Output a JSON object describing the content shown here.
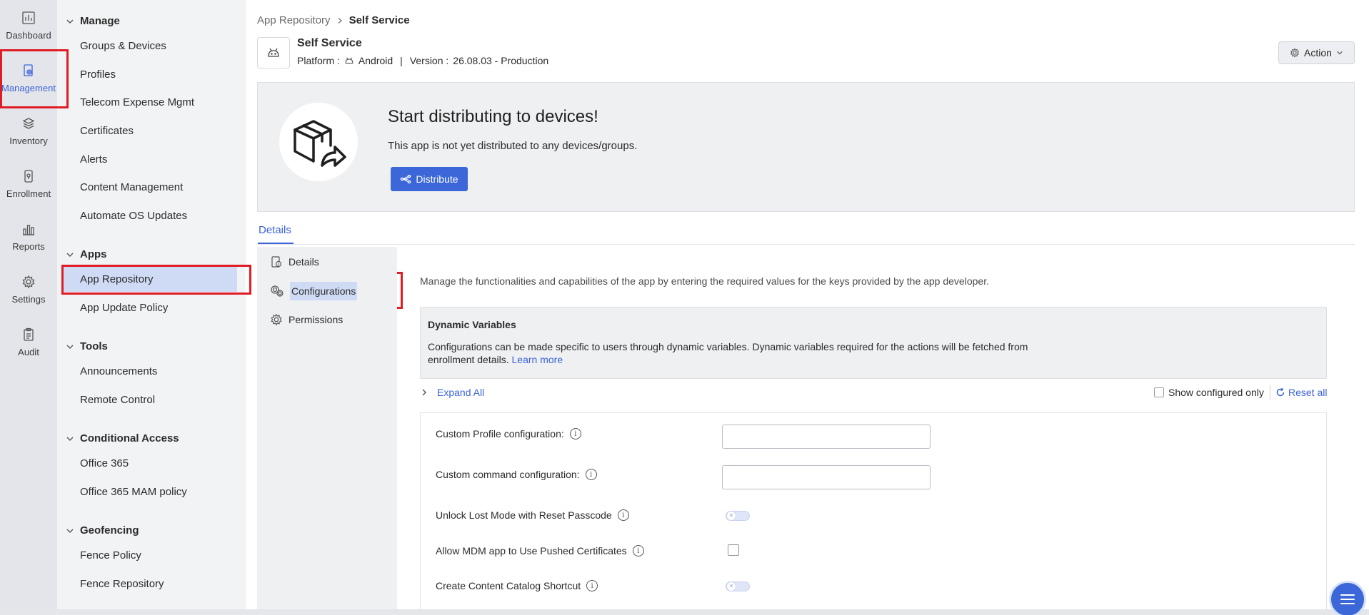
{
  "rail": [
    {
      "label": "Dashboard",
      "icon": "dashboard-icon"
    },
    {
      "label": "Management",
      "icon": "management-icon"
    },
    {
      "label": "Inventory",
      "icon": "inventory-icon"
    },
    {
      "label": "Enrollment",
      "icon": "enrollment-icon"
    },
    {
      "label": "Reports",
      "icon": "reports-icon"
    },
    {
      "label": "Settings",
      "icon": "settings-icon"
    },
    {
      "label": "Audit",
      "icon": "audit-icon"
    }
  ],
  "nav": {
    "manage": {
      "title": "Manage",
      "items": [
        "Groups & Devices",
        "Profiles",
        "Telecom Expense Mgmt",
        "Certificates",
        "Alerts",
        "Content Management",
        "Automate OS Updates"
      ]
    },
    "apps": {
      "title": "Apps",
      "items": [
        "App Repository",
        "App Update Policy"
      ]
    },
    "tools": {
      "title": "Tools",
      "items": [
        "Announcements",
        "Remote Control"
      ]
    },
    "conditional": {
      "title": "Conditional Access",
      "items": [
        "Office 365",
        "Office 365 MAM policy"
      ]
    },
    "geofencing": {
      "title": "Geofencing",
      "items": [
        "Fence Policy",
        "Fence Repository"
      ]
    }
  },
  "breadcrumb": {
    "parent": "App Repository",
    "current": "Self Service"
  },
  "app": {
    "name": "Self Service",
    "platform_label": "Platform :",
    "platform": "Android",
    "separator": "|",
    "version_label": "Version :",
    "version": "26.08.03 - Production"
  },
  "action_label": "Action",
  "banner": {
    "title": "Start distributing to devices!",
    "text": "This app is not yet distributed to any devices/groups.",
    "button": "Distribute"
  },
  "tab": "Details",
  "subnav": [
    "Details",
    "Configurations",
    "Permissions"
  ],
  "content": {
    "description": "Manage the functionalities and capabilities of the app by entering the required values for the keys provided by the app developer.",
    "dynamic": {
      "title": "Dynamic Variables",
      "text": "Configurations can be made specific to users through dynamic variables. Dynamic variables required for the actions will be fetched from enrollment details.",
      "link": "Learn more"
    },
    "expand_all": "Expand All",
    "show_configured": "Show configured only",
    "reset_all": "Reset all",
    "configs": [
      {
        "label": "Custom Profile configuration:",
        "control": "input",
        "value": ""
      },
      {
        "label": "Custom command configuration:",
        "control": "input",
        "value": ""
      },
      {
        "label": "Unlock Lost Mode with Reset Passcode",
        "control": "toggle",
        "value": false
      },
      {
        "label": "Allow MDM app to Use Pushed Certificates",
        "control": "checkbox",
        "value": false
      },
      {
        "label": "Create Content Catalog Shortcut",
        "control": "toggle",
        "value": false
      }
    ]
  },
  "colors": {
    "accent": "#3c67d9",
    "highlight": "#e01d25",
    "selected_bg": "#cfdaf5"
  }
}
